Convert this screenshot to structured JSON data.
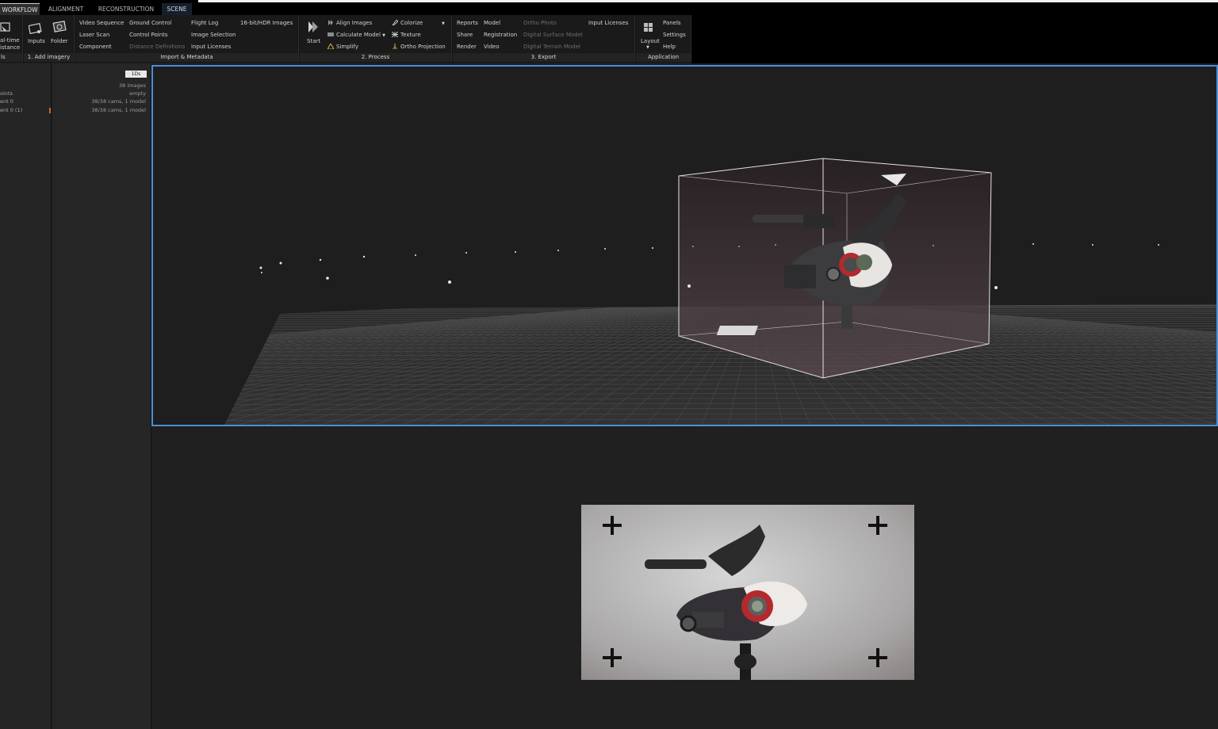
{
  "tabs": [
    {
      "label": "WORKFLOW"
    },
    {
      "label": "ALIGNMENT"
    },
    {
      "label": "RECONSTRUCTION"
    },
    {
      "label": "SCENE"
    }
  ],
  "ribbon": {
    "groups": {
      "g0": {
        "label": "ls",
        "btn_top": "al-time",
        "btn_bottom": "istance"
      },
      "g1": {
        "label": "1. Add imagery",
        "inputs": "Inputs",
        "folder": "Folder"
      },
      "g2": {
        "label": "Import & Metadata",
        "col1": [
          "Video Sequence",
          "Laser Scan",
          "Component"
        ],
        "col2": [
          "Ground Control",
          "Control Points",
          "Distance Definitions"
        ],
        "col3": [
          "Flight Log",
          "Image Selection",
          "Input Licenses"
        ],
        "col4": [
          "16-bit/HDR Images"
        ]
      },
      "g3": {
        "label": "2. Process",
        "start": "Start",
        "col1": [
          "Align Images",
          "Calculate Model",
          "Simplify"
        ],
        "col2": [
          "Colorize",
          "Texture",
          "Ortho Projection"
        ]
      },
      "g4": {
        "label": "3. Export",
        "col1": [
          "Reports",
          "Share",
          "Render"
        ],
        "col2": [
          "Model",
          "Registration",
          "Video"
        ],
        "col3": [
          "Ortho Photo",
          "Digital Surface Model",
          "Digital Terrain Model"
        ],
        "col4": [
          "Input Licenses"
        ]
      },
      "g5": {
        "label": "Application",
        "layout": "Layout",
        "col1": [
          "Panels",
          "Settings",
          "Help"
        ]
      }
    }
  },
  "panel": {
    "chip": "1Ds",
    "tree": [
      "oints",
      "ent 0",
      "ent 0 (1)"
    ],
    "values": [
      "38 images",
      "empty",
      "38/38 cams, 1 model",
      "38/38 cams, 1 model"
    ]
  },
  "colors": {
    "accent": "#4a8fd8",
    "marker": "#d16a1e"
  },
  "icons": [
    "chevron-down-icon",
    "folder-icon",
    "inputs-icon",
    "start-icon",
    "align-icon",
    "model-icon",
    "simplify-icon",
    "colorize-icon",
    "texture-icon",
    "ortho-icon",
    "layout-icon"
  ]
}
